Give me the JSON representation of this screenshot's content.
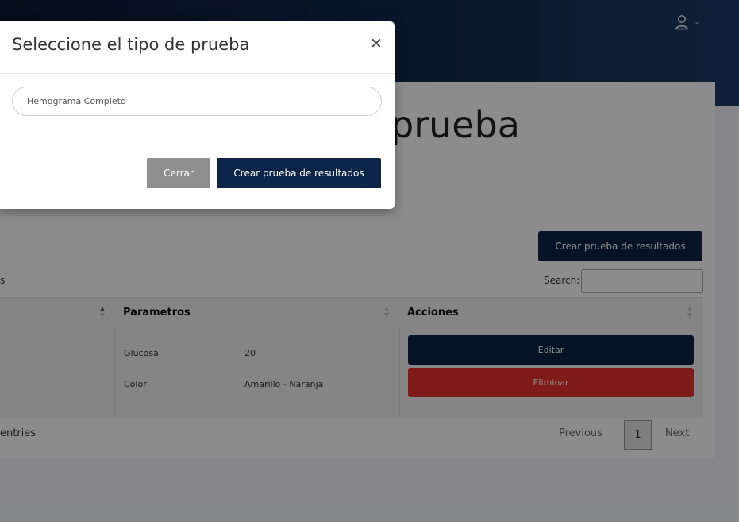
{
  "header": {
    "user_caret": "-"
  },
  "page": {
    "title_fragment": "prueba",
    "create_button": "Crear prueba de resultados"
  },
  "table_controls": {
    "entries_fragment": "s",
    "search_label": "Search:",
    "search_value": ""
  },
  "table": {
    "headers": [
      "Parametros",
      "Acciones"
    ],
    "row": {
      "params": [
        {
          "name": "Glucosa",
          "value": "20"
        },
        {
          "name": "Color",
          "value": "Amarillo - Naranja"
        }
      ],
      "edit_label": "Editar",
      "delete_label": "Eliminar"
    }
  },
  "footer": {
    "info_fragment": "entries",
    "previous": "Previous",
    "page": "1",
    "next": "Next"
  },
  "modal": {
    "title": "Seleccione el tipo de prueba",
    "close_symbol": "×",
    "selected_test": "Hemograma Completo",
    "close_button": "Cerrar",
    "create_button": "Crear prueba de resultados"
  },
  "colors": {
    "primary": "#0b2447",
    "danger": "#e8322f",
    "secondary": "#8f8f8f"
  }
}
